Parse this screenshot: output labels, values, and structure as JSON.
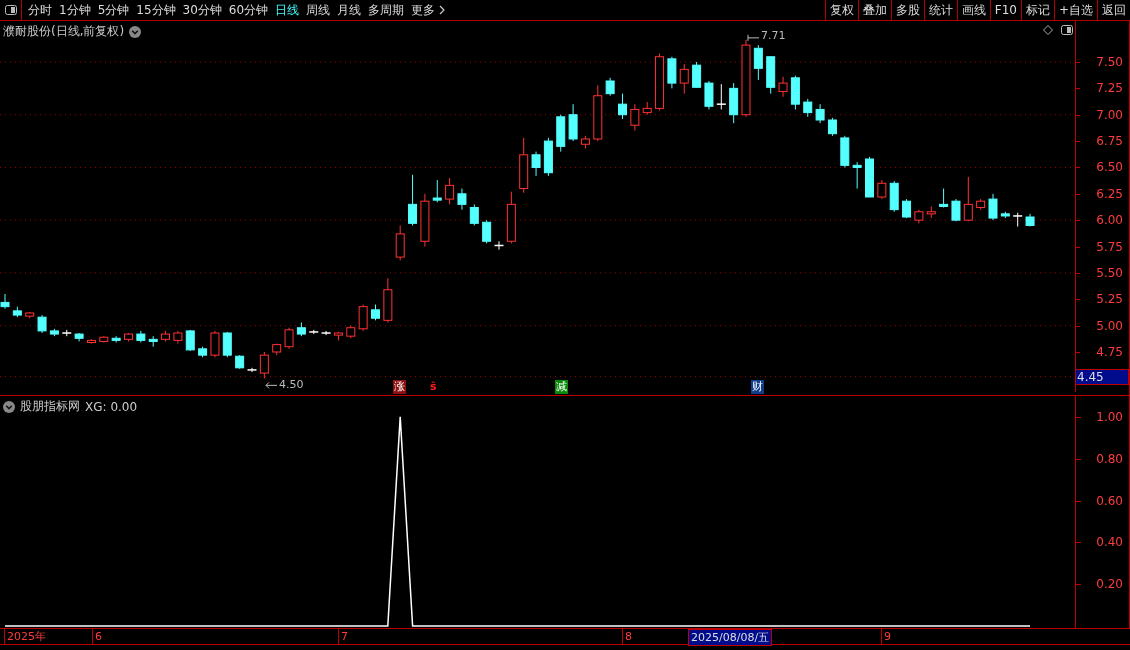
{
  "toolbar": {
    "period_tabs": [
      {
        "label": "分时",
        "selected": false
      },
      {
        "label": "1分钟",
        "selected": false
      },
      {
        "label": "5分钟",
        "selected": false
      },
      {
        "label": "15分钟",
        "selected": false
      },
      {
        "label": "30分钟",
        "selected": false
      },
      {
        "label": "60分钟",
        "selected": false
      },
      {
        "label": "日线",
        "selected": true
      },
      {
        "label": "周线",
        "selected": false
      },
      {
        "label": "月线",
        "selected": false
      },
      {
        "label": "多周期",
        "selected": false
      },
      {
        "label": "更多",
        "selected": false
      }
    ],
    "actions": [
      "复权",
      "叠加",
      "多股",
      "统计",
      "画线",
      "F10",
      "标记",
      "+自选",
      "返回"
    ]
  },
  "price_panel": {
    "title": "濮耐股份(日线,前复权)",
    "high_label": "7.71",
    "low_label": "4.50",
    "y_axis": [
      "7.50",
      "7.25",
      "7.00",
      "6.75",
      "6.50",
      "6.25",
      "6.00",
      "5.75",
      "5.50",
      "5.25",
      "5.00",
      "4.75"
    ],
    "current_price": "4.45",
    "event_tags": [
      {
        "label": "涨",
        "kind": "badge",
        "color": "#8c1010"
      },
      {
        "label": "ŝ",
        "kind": "plain",
        "color": "#ff2020"
      },
      {
        "label": "减",
        "kind": "badge",
        "color": "#0a8a0a"
      },
      {
        "label": "财",
        "kind": "badge",
        "color": "#103c8c"
      }
    ]
  },
  "indicator_panel": {
    "title": "股朋指标网",
    "reading": ": 0.00",
    "chart_data": {
      "type": "line",
      "ylim": [
        0,
        1.1
      ],
      "yticks": [
        {
          "value": 1,
          "label": "1.00"
        },
        {
          "value": 0.8,
          "label": "0.80"
        },
        {
          "value": 0.6,
          "label": "0.60"
        },
        {
          "value": 0.4,
          "label": "0.40"
        },
        {
          "value": 0.2,
          "label": "0.20"
        }
      ],
      "series": [
        {
          "name": "XG",
          "color": "#ffffff",
          "values": [
            0,
            0,
            0,
            0,
            0,
            0,
            0,
            0,
            0,
            0,
            0,
            0,
            0,
            0,
            0,
            0,
            0,
            0,
            0,
            0,
            0,
            0,
            0,
            0,
            0,
            0,
            0,
            0,
            0,
            0,
            0,
            0,
            1,
            0,
            0,
            0,
            0,
            0,
            0,
            0,
            0,
            0,
            0,
            0,
            0,
            0,
            0,
            0,
            0,
            0,
            0,
            0,
            0,
            0,
            0,
            0,
            0,
            0,
            0,
            0,
            0,
            0,
            0,
            0,
            0,
            0,
            0,
            0,
            0,
            0,
            0,
            0,
            0,
            0,
            0,
            0,
            0,
            0,
            0,
            0,
            0,
            0,
            0,
            0
          ]
        }
      ]
    }
  },
  "time_axis": {
    "labels": [
      "2025年",
      "6",
      "7",
      "8"
    ],
    "cursor_date": "2025/08/08/五",
    "labels_after": [
      "9"
    ]
  }
}
